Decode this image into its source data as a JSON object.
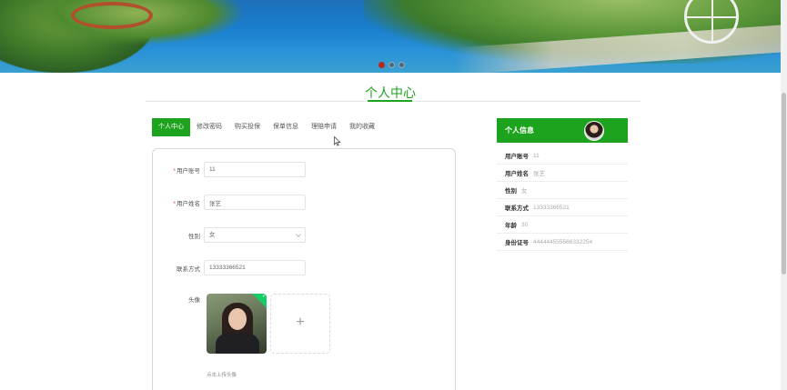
{
  "banner": {
    "slides": 3,
    "active_slide": 1
  },
  "page_title": "个人中心",
  "tabs": [
    {
      "label": "个人中心",
      "active": true
    },
    {
      "label": "修改密码",
      "active": false
    },
    {
      "label": "购买投保",
      "active": false
    },
    {
      "label": "保单信息",
      "active": false
    },
    {
      "label": "理赔申请",
      "active": false
    },
    {
      "label": "我的收藏",
      "active": false
    }
  ],
  "form": {
    "account": {
      "label": "用户账号",
      "value": "11",
      "required": true
    },
    "name": {
      "label": "用户姓名",
      "value": "张艺",
      "required": true
    },
    "gender": {
      "label": "性别",
      "value": "女"
    },
    "phone": {
      "label": "联系方式",
      "value": "13333366521"
    },
    "avatar": {
      "label": "头像",
      "add_symbol": "+",
      "hint": "点击上传头像",
      "uploaded_mark": "✓"
    }
  },
  "info": {
    "title": "个人信息",
    "rows": [
      {
        "key": "用户账号",
        "value": "11"
      },
      {
        "key": "用户姓名",
        "value": "张艺"
      },
      {
        "key": "性别",
        "value": "女"
      },
      {
        "key": "联系方式",
        "value": "13333366521"
      },
      {
        "key": "年龄",
        "value": "30"
      },
      {
        "key": "身份证号",
        "value": "444444555566332254"
      }
    ]
  },
  "colors": {
    "accent": "#1ea31e",
    "required": "#ee3333",
    "slide_active": "#b5281c"
  }
}
